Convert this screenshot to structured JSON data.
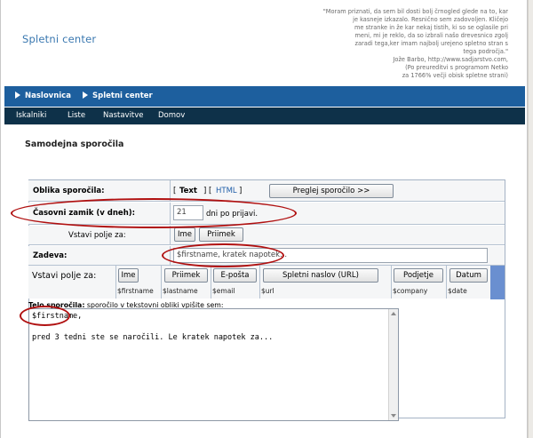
{
  "header": {
    "site_title": "Spletni center",
    "quote_lines": [
      "\"Moram priznati, da sem bil dosti bolj črnogled glede na to, kar",
      "je kasneje izkazalo. Resnično sem zadovoljen. Kličejo",
      "me stranke in že kar nekaj tistih, ki so se oglasile pri",
      "meni, mi je reklo, da so izbrali našo drevesnico zgolj",
      "zaradi tega,ker imam najbolj urejeno spletno stran s",
      "tega področja.\"",
      "Jože Barbo, http://www.sadjarstvo.com,",
      "(Po preureditvi s programom Netko",
      "za 1766% večji obisk spletne strani)"
    ]
  },
  "breadcrumb": {
    "items": [
      "Naslovnica",
      "Spletni center"
    ]
  },
  "menu": {
    "items": [
      "Iskalniki",
      "Liste",
      "Nastavitve",
      "Domov"
    ]
  },
  "page": {
    "heading": "Samodejna sporočila"
  },
  "form": {
    "format": {
      "label": "Oblika sporočila:",
      "bracket_open": "[",
      "text_option": "Text",
      "separator": "] [",
      "html_option": "HTML",
      "bracket_close": "]",
      "preview_button": "Preglej sporočilo >>"
    },
    "delay": {
      "label": "Časovni zamik (v dneh):",
      "value": "21",
      "suffix": "dni po prijavi."
    },
    "insert_field_1": {
      "label": "Vstavi polje za:",
      "buttons": [
        "Ime",
        "Priimek"
      ]
    },
    "subject": {
      "label": "Zadeva:",
      "value": "$firstname, kratek napotek..."
    },
    "insert_field_2": {
      "label": "Vstavi polje za:",
      "buttons": [
        "Ime",
        "Priimek",
        "E-pošta",
        "Spletni naslov (URL)",
        "Podjetje",
        "Datum"
      ],
      "variables": [
        "$firstname",
        "$lastname",
        "$email",
        "$url",
        "$company",
        "$date"
      ]
    },
    "body": {
      "label_bold": "Telo sporočila:",
      "label_rest": " sporočilo v tekstovni obliki vpišite sem:",
      "lines": [
        "$firstname,",
        "",
        "pred 3 tedni ste se naročili. Le kratek napotek za..."
      ]
    }
  },
  "colors": {
    "accent": "#1d5f9e",
    "menu": "#0e3149",
    "annotation": "#b01010",
    "title": "#3a78b0"
  }
}
